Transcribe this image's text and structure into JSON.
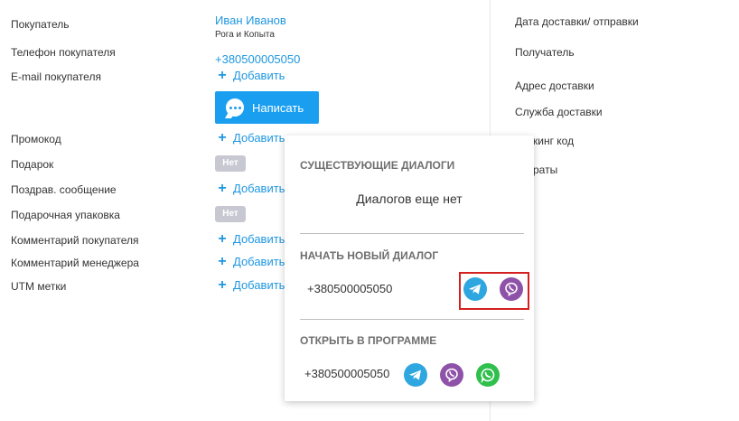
{
  "left_fields": [
    {
      "label": "Покупатель"
    },
    {
      "label": "Телефон покупателя"
    },
    {
      "label": "E-mail покупателя"
    },
    {
      "label": "Промокод"
    },
    {
      "label": "Подарок"
    },
    {
      "label": "Поздрав. сообщение"
    },
    {
      "label": "Подарочная упаковка"
    },
    {
      "label": "Комментарий покупателя"
    },
    {
      "label": "Комментарий менеджера"
    },
    {
      "label": "UTM метки"
    }
  ],
  "buyer": {
    "name": "Иван Иванов",
    "company": "Рога и Копыта",
    "phone": "+380500005050"
  },
  "add_label": "Добавить",
  "no_badge": "Нет",
  "write_button": "Написать",
  "right_fields": [
    "Дата доставки/ отправки",
    "Получатель",
    "Адрес доставки",
    "Служба доставки",
    "кинг код",
    "раты"
  ],
  "popup": {
    "existing_title": "СУЩЕСТВУЮЩИЕ ДИАЛОГИ",
    "no_dialogs": "Диалогов еще нет",
    "new_title": "НАЧАТЬ НОВЫЙ ДИАЛОГ",
    "new_phone": "+380500005050",
    "open_title": "ОТКРЫТЬ В ПРОГРАММЕ",
    "open_phone": "+380500005050"
  },
  "icons": {
    "telegram": "telegram-icon",
    "viber": "viber-icon",
    "whatsapp": "whatsapp-icon",
    "chat": "chat-bubble-icon",
    "plus": "plus-icon"
  },
  "colors": {
    "accent": "#1a9ff0",
    "link": "#1f97e0",
    "telegram": "#2ea6df",
    "viber": "#8e52a8",
    "whatsapp": "#2fbf4c",
    "highlight": "#d4201f"
  }
}
